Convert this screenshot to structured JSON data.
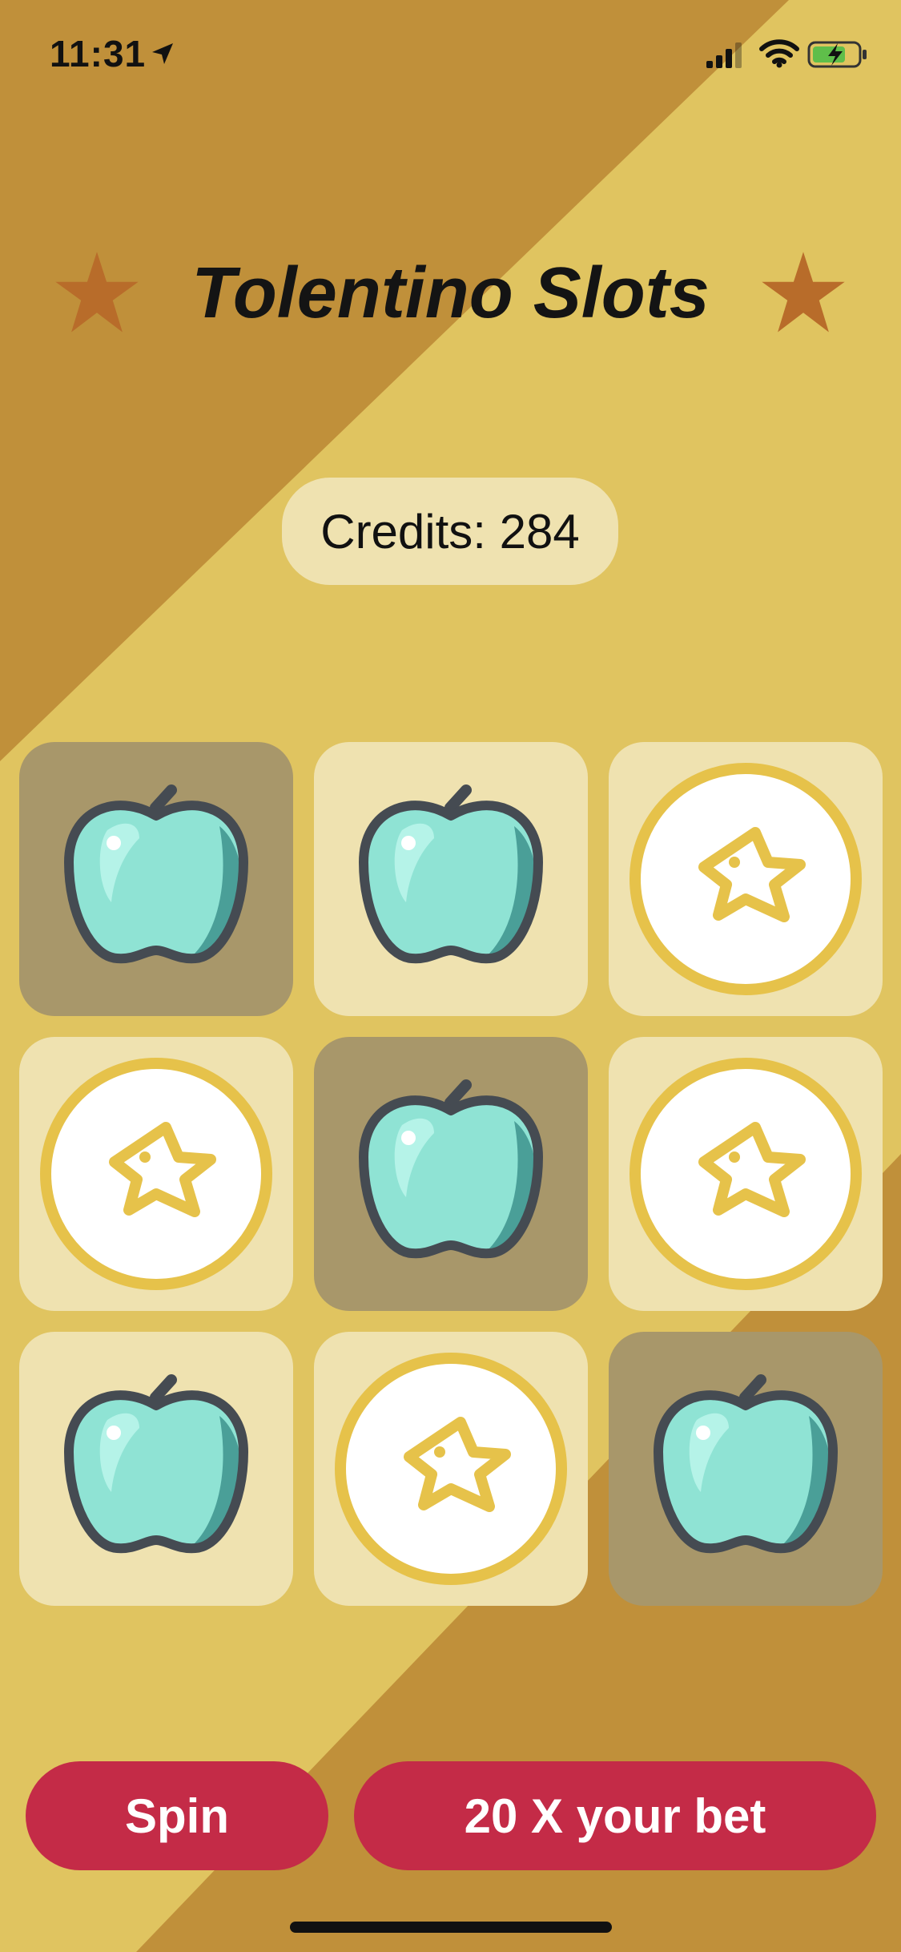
{
  "status_bar": {
    "time": "11:31",
    "icons": [
      "location-arrow-icon",
      "cellular-signal-icon",
      "wifi-icon",
      "battery-charging-icon"
    ]
  },
  "title": {
    "text": "Tolentino Slots",
    "decoration_icon": "star-icon"
  },
  "credits": {
    "label": "Credits: 284"
  },
  "grid": {
    "cells": [
      {
        "symbol": "apple",
        "highlighted": true
      },
      {
        "symbol": "apple",
        "highlighted": false
      },
      {
        "symbol": "star",
        "highlighted": false
      },
      {
        "symbol": "star",
        "highlighted": false
      },
      {
        "symbol": "apple",
        "highlighted": true
      },
      {
        "symbol": "star",
        "highlighted": false
      },
      {
        "symbol": "apple",
        "highlighted": false
      },
      {
        "symbol": "star",
        "highlighted": false
      },
      {
        "symbol": "apple",
        "highlighted": true
      }
    ]
  },
  "buttons": {
    "spin_label": "Spin",
    "bet_label": "20 X your bet"
  },
  "colors": {
    "background_dark": "#c0903a",
    "background_light": "#e0c460",
    "cell_normal": "#efe2b0",
    "cell_highlight": "#a8976a",
    "button": "#c42b47",
    "star_decoration": "#b86c2a",
    "coin_ring": "#e6c24a",
    "apple_body": "#8fe3d4",
    "apple_shade": "#4a9f98",
    "apple_outline": "#454b52"
  }
}
